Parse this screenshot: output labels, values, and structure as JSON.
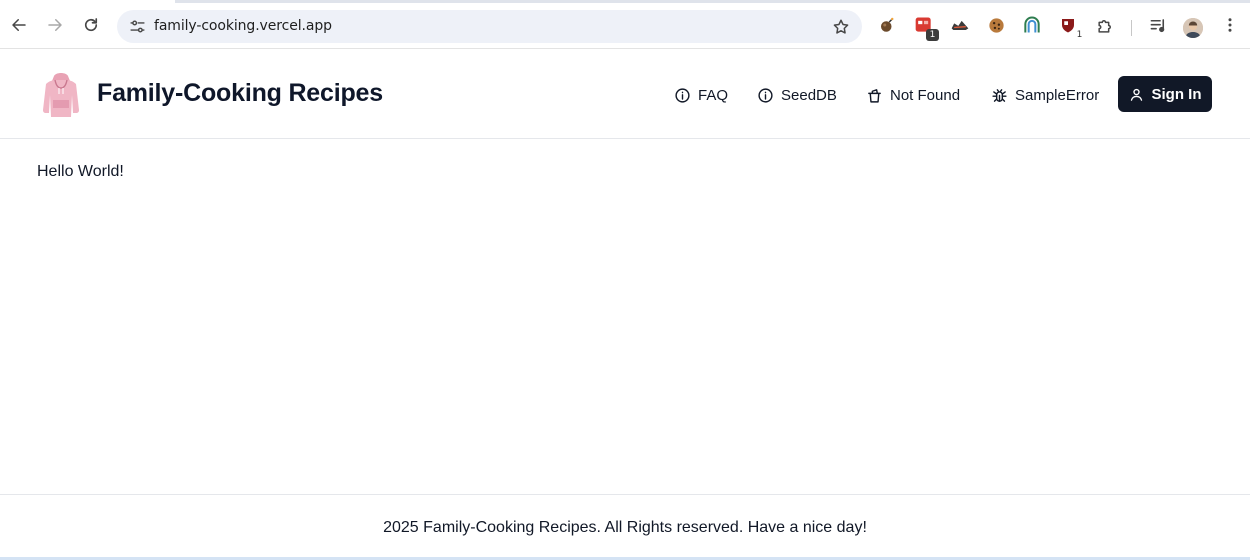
{
  "browser": {
    "url": "family-cooking.vercel.app",
    "extensions": [
      {
        "icon": "bomb-extension-icon",
        "badge": ""
      },
      {
        "icon": "red-grid-extension-icon",
        "badge": "1"
      },
      {
        "icon": "sneaker-extension-icon",
        "badge": ""
      },
      {
        "icon": "cookie-extension-icon",
        "badge": ""
      },
      {
        "icon": "arch-extension-icon",
        "badge": ""
      },
      {
        "icon": "shield-extension-icon",
        "badge": "1"
      }
    ]
  },
  "header": {
    "title": "Family-Cooking Recipes",
    "nav": [
      {
        "label": "FAQ",
        "icon": "info-icon"
      },
      {
        "label": "SeedDB",
        "icon": "info-icon"
      },
      {
        "label": "Not Found",
        "icon": "trash-icon"
      },
      {
        "label": "SampleError",
        "icon": "bug-icon"
      }
    ],
    "signin_label": "Sign In"
  },
  "main": {
    "message": "Hello World!"
  },
  "footer": {
    "text": "2025 Family-Cooking Recipes. All Rights reserved. Have a nice day!"
  },
  "colors": {
    "signin_bg": "#111827",
    "omnibox_bg": "#eef1f8",
    "text": "#111827"
  }
}
